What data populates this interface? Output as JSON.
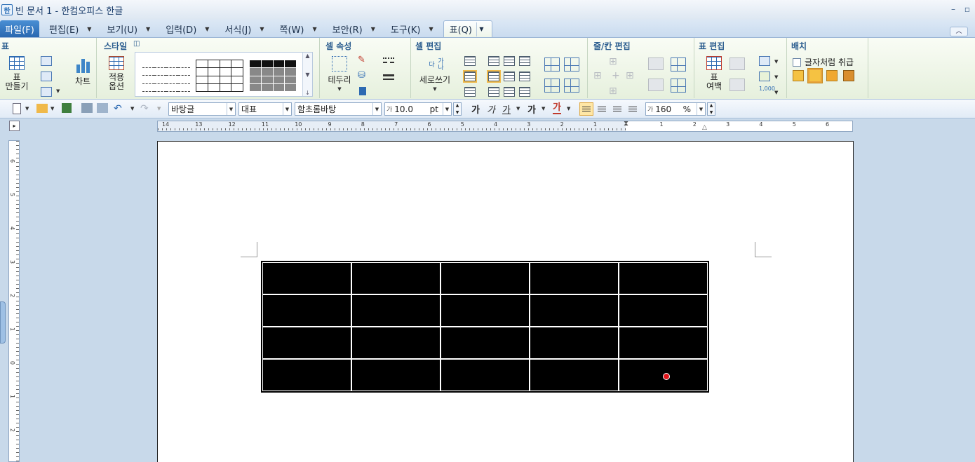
{
  "window": {
    "title": "빈 문서 1 - 한컴오피스 한글"
  },
  "menu": {
    "file": "파일(F)",
    "items": [
      "편집(E)",
      "보기(U)",
      "입력(D)",
      "서식(J)",
      "쪽(W)",
      "보안(R)",
      "도구(K)"
    ],
    "active": "표(Q)"
  },
  "ribbon": {
    "table_group": {
      "title": "표",
      "make_table": "표\n만들기",
      "chart": "차트"
    },
    "style_group": {
      "title": "스타일",
      "apply_options": "적용\n옵션"
    },
    "cell_attr_group": {
      "title": "셀 속성",
      "border": "테두리"
    },
    "cell_edit_group": {
      "title": "셀 편집",
      "vertical_writing": "세로쓰기",
      "vertical_icon_text": "가나다"
    },
    "row_col_group": {
      "title": "줄/칸 편집"
    },
    "table_edit_group": {
      "title": "표 편집",
      "table_margin": "표\n여백",
      "number_icon_text": "1,000"
    },
    "layout_group": {
      "title": "배치",
      "treat_as_char": "글자처럼 취급"
    }
  },
  "format_toolbar": {
    "style": "바탕글",
    "lang": "대표",
    "font": "함초롬바탕",
    "size_icon": "가",
    "size": "10.0",
    "size_unit": "pt",
    "bold": "가",
    "italic": "가",
    "underline": "가",
    "strike": "가",
    "color": "가",
    "spacing_icon": "가",
    "line_spacing": "160",
    "line_spacing_unit": "%"
  },
  "ruler": {
    "ticks": [
      "14",
      "13",
      "12",
      "11",
      "10",
      "9",
      "8",
      "7",
      "6",
      "5",
      "4",
      "3",
      "2",
      "1",
      "",
      "1",
      "2",
      "3",
      "4",
      "5",
      "6"
    ],
    "vticks": [
      "6",
      "5",
      "4",
      "3",
      "2",
      "1",
      "0",
      "1",
      "2"
    ]
  },
  "document": {
    "table": {
      "rows": 4,
      "cols": 5
    }
  }
}
